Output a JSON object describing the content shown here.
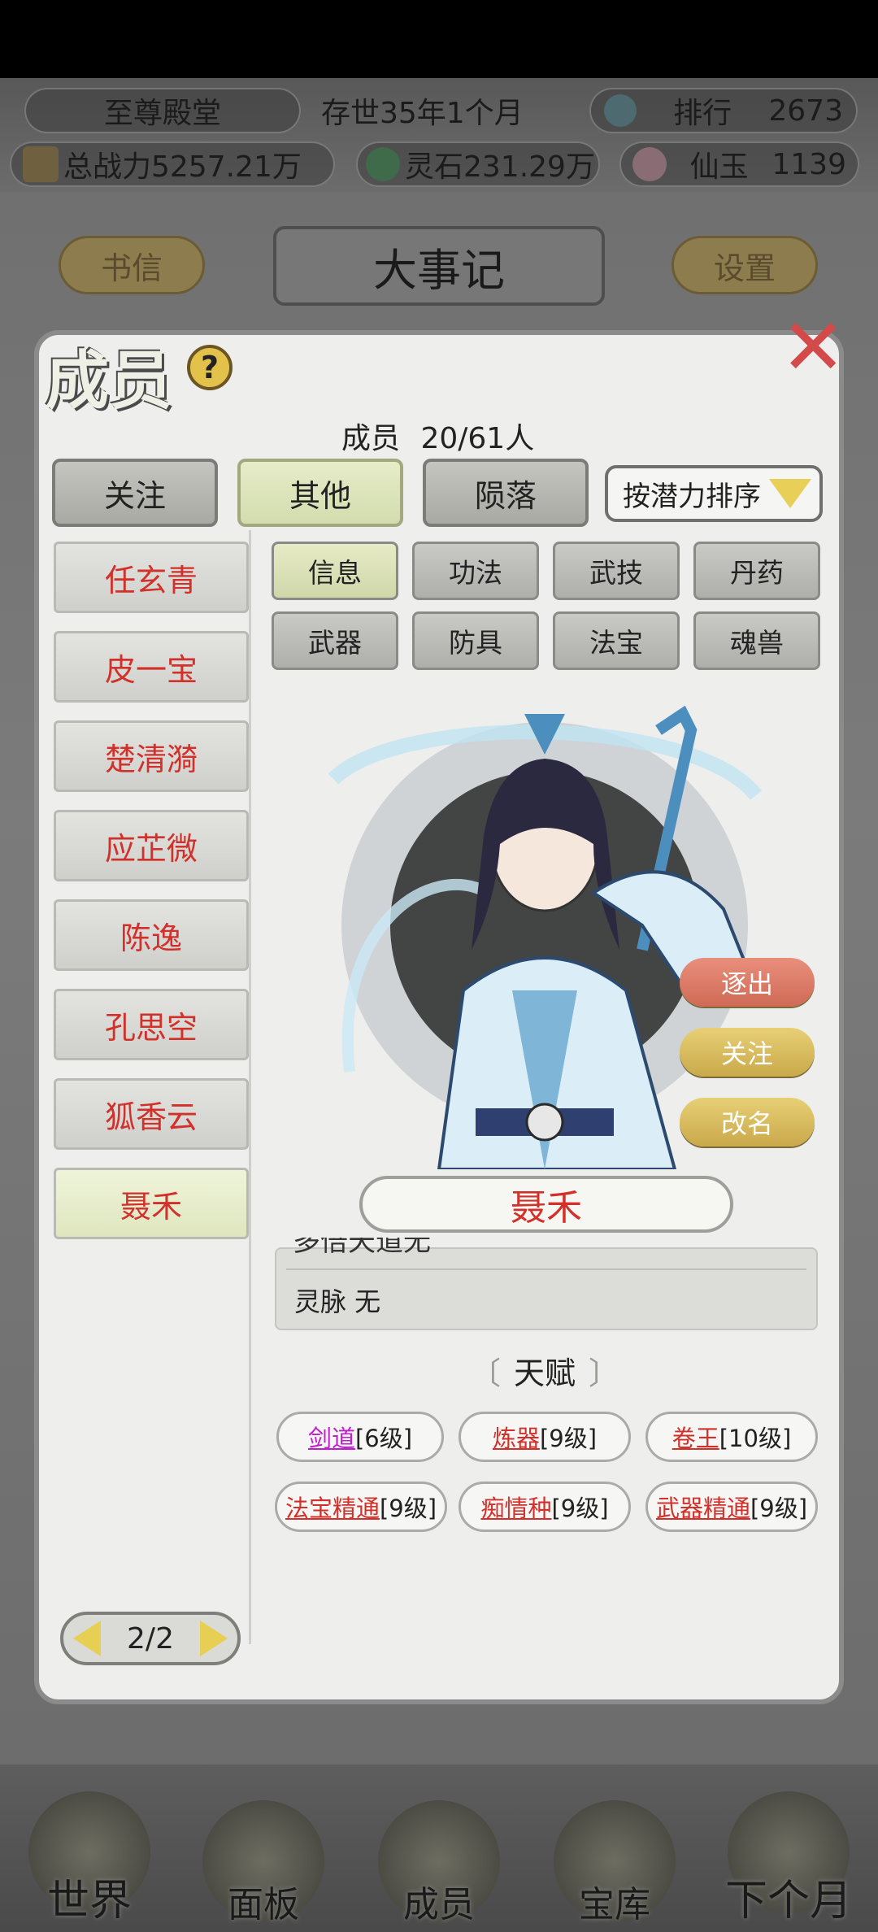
{
  "top": {
    "hall": "至尊殿堂",
    "age": "存世35年1个月",
    "rank_label": "排行",
    "rank_value": "2673",
    "power": "总战力5257.21万",
    "spirit_stone": "灵石231.29万",
    "jade_label": "仙玉",
    "jade_value": "1139",
    "letters_btn": "书信",
    "title": "大事记",
    "settings_btn": "设置"
  },
  "panel": {
    "title": "成员",
    "count_label": "成员",
    "count_value": "20/61人",
    "tabs": [
      {
        "label": "关注",
        "active": false
      },
      {
        "label": "其他",
        "active": true
      },
      {
        "label": "陨落",
        "active": false
      }
    ],
    "sort_label": "按潜力排序",
    "members": [
      {
        "name": "任玄青",
        "selected": false
      },
      {
        "name": "皮一宝",
        "selected": false
      },
      {
        "name": "楚清漪",
        "selected": false
      },
      {
        "name": "应芷微",
        "selected": false
      },
      {
        "name": "陈逸",
        "selected": false
      },
      {
        "name": "孔思空",
        "selected": false
      },
      {
        "name": "狐香云",
        "selected": false
      },
      {
        "name": "聂禾",
        "selected": true
      }
    ],
    "sub_tabs_row1": [
      {
        "label": "信息",
        "active": true
      },
      {
        "label": "功法",
        "active": false
      },
      {
        "label": "武技",
        "active": false
      },
      {
        "label": "丹药",
        "active": false
      }
    ],
    "sub_tabs_row2": [
      {
        "label": "武器",
        "active": false
      },
      {
        "label": "防具",
        "active": false
      },
      {
        "label": "法宝",
        "active": false
      },
      {
        "label": "魂兽",
        "active": false
      }
    ],
    "actions": {
      "expel": "逐出",
      "follow": "关注",
      "rename": "改名"
    },
    "character_name": "聂禾",
    "cut_off_line": "多倍天道无",
    "spirit_vein": "灵脉 无",
    "talent_heading": "天赋",
    "talents": [
      {
        "name": "剑道",
        "level": "[6级]",
        "color": "#c21ccf"
      },
      {
        "name": "炼器",
        "level": "[9级]",
        "color": "#d1312a"
      },
      {
        "name": "卷王",
        "level": "[10级]",
        "color": "#d1312a"
      },
      {
        "name": "法宝精通",
        "level": "[9级]",
        "color": "#d1312a"
      },
      {
        "name": "痴情种",
        "level": "[9级]",
        "color": "#d1312a"
      },
      {
        "name": "武器精通",
        "level": "[9级]",
        "color": "#d1312a"
      }
    ],
    "page": "2/2"
  },
  "bottom_nav": [
    "世界",
    "面板",
    "成员",
    "宝库",
    "下个月"
  ]
}
